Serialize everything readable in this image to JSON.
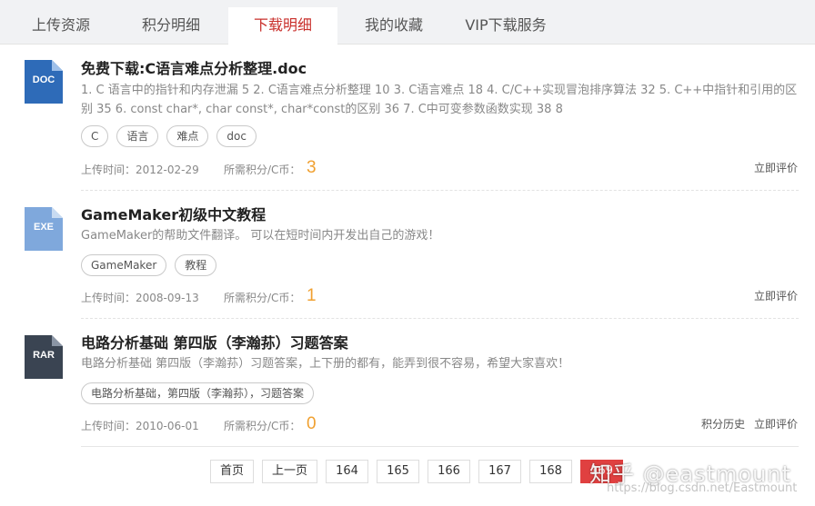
{
  "tabs": [
    {
      "label": "上传资源"
    },
    {
      "label": "积分明细"
    },
    {
      "label": "下载明细",
      "active": true
    },
    {
      "label": "我的收藏"
    },
    {
      "label": "VIP下载服务"
    }
  ],
  "colors": {
    "accent": "#c9302c",
    "price": "#f0a030",
    "doc": "#2e6bb8",
    "exe": "#7fa8dc",
    "rar": "#3a4452"
  },
  "items": [
    {
      "icon": {
        "name": "doc-file-icon",
        "ext": "DOC",
        "color": "#2e6bb8"
      },
      "title": "免费下载:C语言难点分析整理.doc",
      "desc": "1. C 语言中的指针和内存泄漏 5 2. C语言难点分析整理 10 3. C语言难点 18 4. C/C++实现冒泡排序算法 32 5. C++中指针和引用的区别 35 6. const char*, char const*, char*const的区别 36 7. C中可变参数函数实现 38 8",
      "tags": [
        "C",
        "语言",
        "难点",
        "doc"
      ],
      "upload_time": "上传时间：2012-02-29",
      "price_label": "所需积分/C币：",
      "price": "3",
      "actions": [
        "立即评价"
      ]
    },
    {
      "icon": {
        "name": "exe-file-icon",
        "ext": "EXE",
        "color": "#7fa8dc"
      },
      "title": "GameMaker初级中文教程",
      "desc": "GameMaker的帮助文件翻译。 可以在短时间内开发出自己的游戏！",
      "tags": [
        "GameMaker",
        "教程"
      ],
      "upload_time": "上传时间：2008-09-13",
      "price_label": "所需积分/C币：",
      "price": "1",
      "actions": [
        "立即评价"
      ]
    },
    {
      "icon": {
        "name": "rar-file-icon",
        "ext": "RAR",
        "color": "#3a4452"
      },
      "title": "电路分析基础 第四版（李瀚荪）习题答案",
      "desc": "电路分析基础 第四版（李瀚荪）习题答案，上下册的都有，能弄到很不容易，希望大家喜欢！",
      "tags": [
        "电路分析基础，第四版（李瀚荪），习题答案"
      ],
      "upload_time": "上传时间：2010-06-01",
      "price_label": "所需积分/C币：",
      "price": "0",
      "actions": [
        "积分历史",
        "立即评价"
      ]
    }
  ],
  "pager": {
    "first": "首页",
    "prev": "上一页",
    "pages": [
      "164",
      "165",
      "166",
      "167",
      "168",
      "169"
    ],
    "current": "169"
  },
  "watermark": {
    "brand": "知乎 @eastmount",
    "url": "https://blog.csdn.net/Eastmount"
  }
}
